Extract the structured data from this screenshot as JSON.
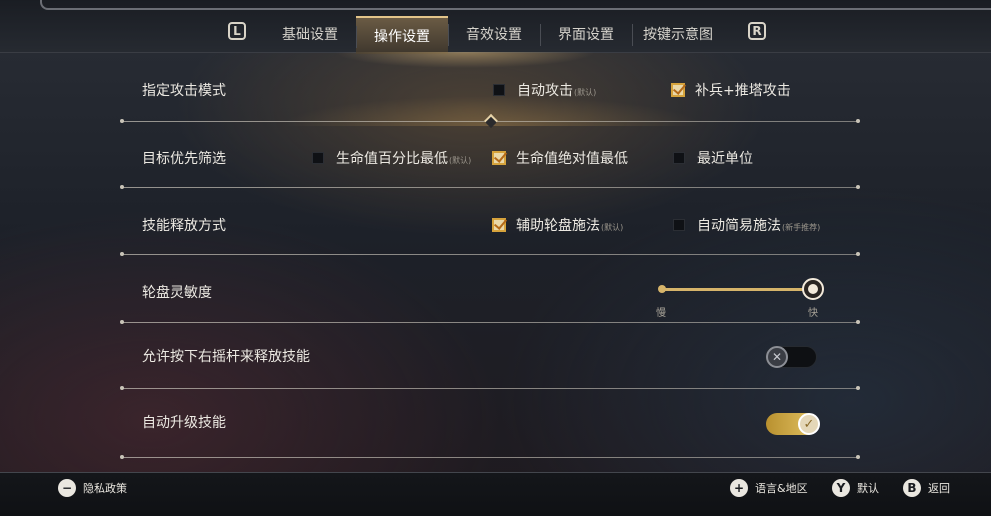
{
  "tabs": {
    "left_bumper": "L",
    "right_bumper": "R",
    "items": [
      "基础设置",
      "操作设置",
      "音效设置",
      "界面设置",
      "按键示意图"
    ],
    "active_index": 1
  },
  "rows": {
    "attack_mode": {
      "label": "指定攻击模式",
      "opt1": {
        "label": "自动攻击",
        "note": "(默认)",
        "checked": false
      },
      "opt2": {
        "label": "补兵+推塔攻击",
        "checked": true
      }
    },
    "target_priority": {
      "label": "目标优先筛选",
      "opt1": {
        "label": "生命值百分比最低",
        "note": "(默认)",
        "checked": false
      },
      "opt2": {
        "label": "生命值绝对值最低",
        "checked": true
      },
      "opt3": {
        "label": "最近单位",
        "checked": false
      }
    },
    "skill_cast": {
      "label": "技能释放方式",
      "opt1": {
        "label": "辅助轮盘施法",
        "note": "(默认)",
        "checked": true
      },
      "opt2": {
        "label": "自动简易施法",
        "note": "(新手推荐)",
        "checked": false
      }
    },
    "wheel_sensitivity": {
      "label": "轮盘灵敏度",
      "min_label": "慢",
      "max_label": "快",
      "value": 1.0
    },
    "right_stick_cast": {
      "label": "允许按下右摇杆来释放技能",
      "enabled": false
    },
    "auto_level_skill": {
      "label": "自动升级技能",
      "enabled": true
    }
  },
  "footer": {
    "privacy": {
      "glyph": "−",
      "label": "隐私政策"
    },
    "language": {
      "glyph": "+",
      "label": "语言&地区"
    },
    "default": {
      "glyph": "Y",
      "label": "默认"
    },
    "back": {
      "glyph": "B",
      "label": "返回"
    }
  },
  "colors": {
    "accent": "#d6a33c",
    "active_tab": "#6a5b44"
  }
}
